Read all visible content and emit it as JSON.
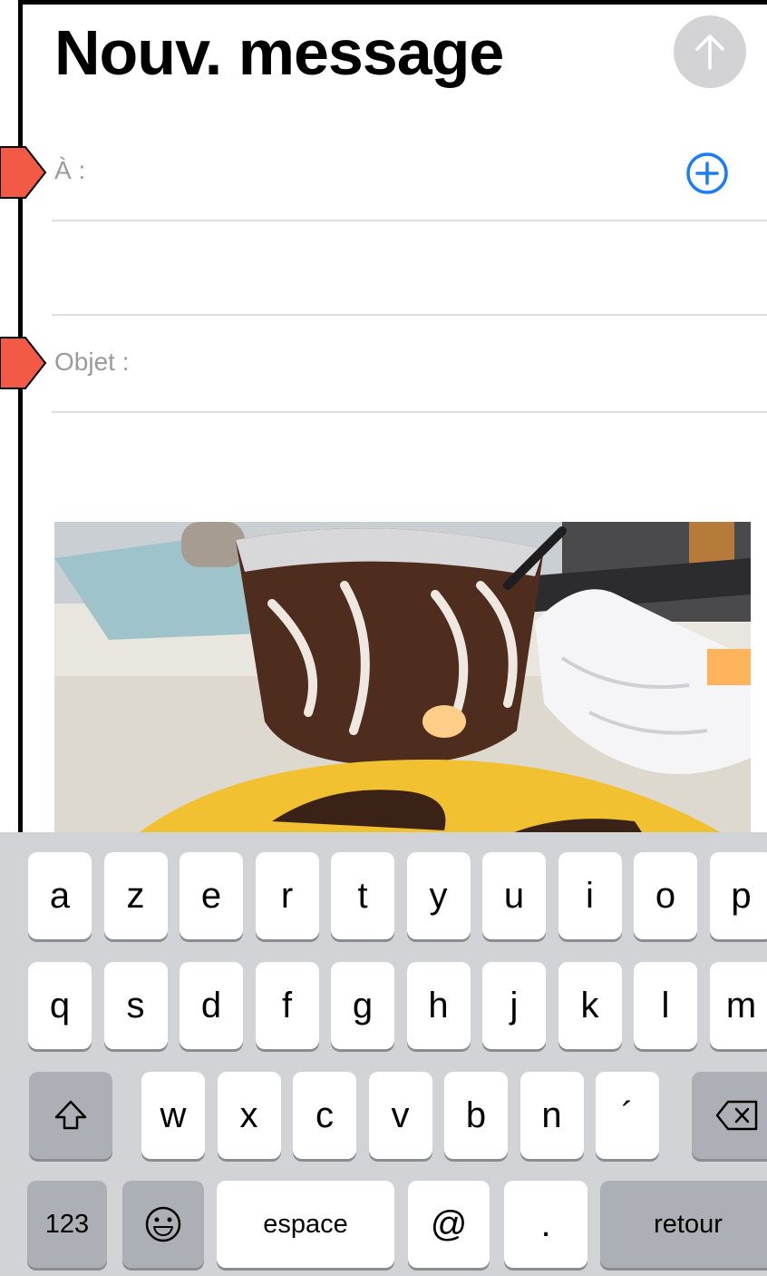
{
  "compose": {
    "title": "Nouv. message",
    "to_label": "À :",
    "subject_label": "Objet :"
  },
  "icons": {
    "send": "arrow-up-icon",
    "add_contact": "plus-circle-icon",
    "shift": "shift-icon",
    "delete": "backspace-icon",
    "emoji": "emoji-icon"
  },
  "colors": {
    "accent": "#1c7cf4",
    "send_disabled": "#d3d3d6",
    "arrow_callout": "#f25a46"
  },
  "keyboard": {
    "row1": [
      "a",
      "z",
      "e",
      "r",
      "t",
      "y",
      "u",
      "i",
      "o",
      "p"
    ],
    "row2": [
      "q",
      "s",
      "d",
      "f",
      "g",
      "h",
      "j",
      "k",
      "l",
      "m"
    ],
    "row3": [
      "w",
      "x",
      "c",
      "v",
      "b",
      "n",
      "´"
    ],
    "numbers_label": "123",
    "space_label": "espace",
    "at_label": "@",
    "period_label": ".",
    "return_label": "retour"
  }
}
